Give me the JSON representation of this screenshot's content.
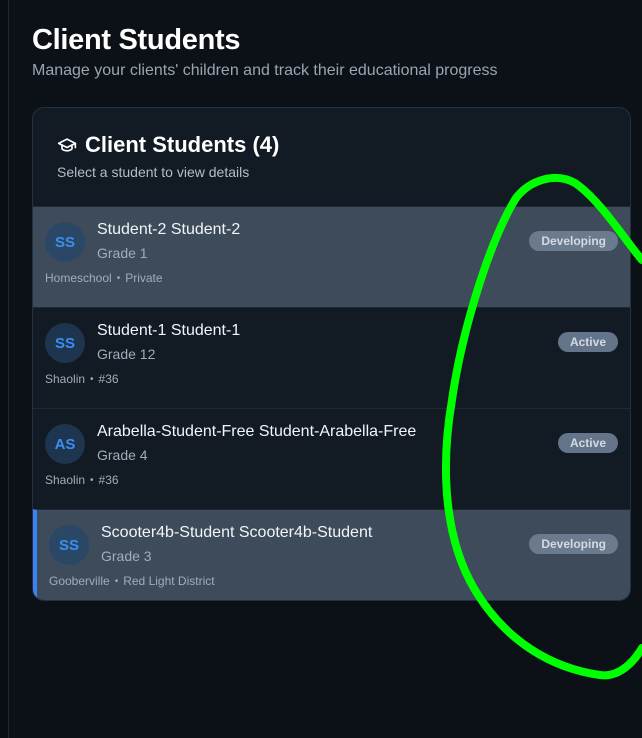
{
  "page": {
    "title": "Client Students",
    "subtitle": "Manage your clients' children and track their educational progress"
  },
  "card": {
    "icon": "graduation-cap-icon",
    "title": "Client Students (4)",
    "description": "Select a student to view details"
  },
  "students": [
    {
      "initials": "SS",
      "name": "Student-2 Student-2",
      "grade": "Grade 1",
      "school": "Homeschool",
      "detail": "Private",
      "status": "Developing"
    },
    {
      "initials": "SS",
      "name": "Student-1 Student-1",
      "grade": "Grade 12",
      "school": "Shaolin",
      "detail": "#36",
      "status": "Active"
    },
    {
      "initials": "AS",
      "name": "Arabella-Student-Free Student-Arabella-Free",
      "grade": "Grade 4",
      "school": "Shaolin",
      "detail": "#36",
      "status": "Active"
    },
    {
      "initials": "SS",
      "name": "Scooter4b-Student Scooter4b-Student",
      "grade": "Grade 3",
      "school": "Gooberville",
      "detail": "Red Light District",
      "status": "Developing"
    }
  ],
  "colors": {
    "background": "#0c1117",
    "card": "#121a23",
    "accent": "#3b82f6",
    "annotation": "#00ff00"
  }
}
